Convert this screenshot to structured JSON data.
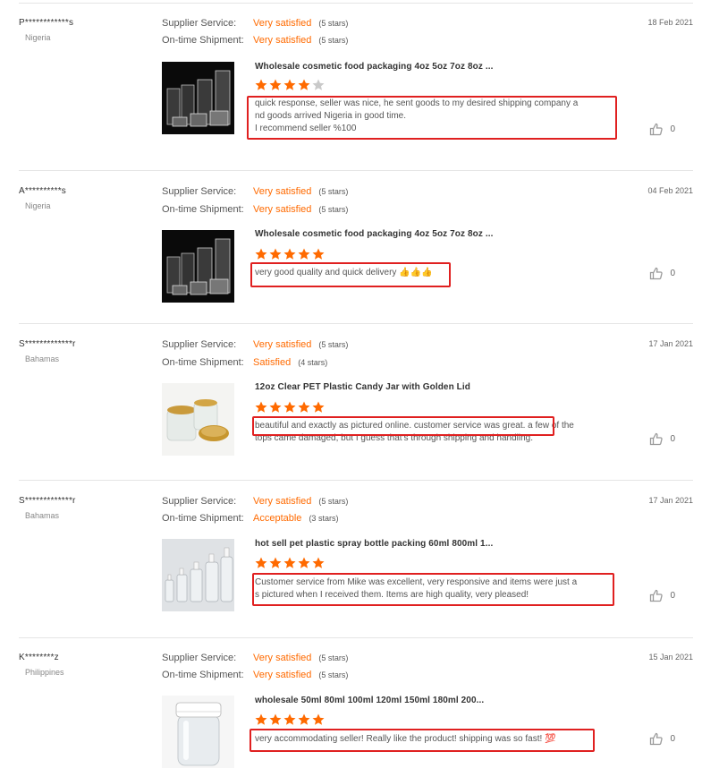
{
  "ratings_labels": {
    "supplier": "Supplier Service:",
    "shipment": "On-time Shipment:"
  },
  "reviews": [
    {
      "buyer": "P************s",
      "country": "Nigeria",
      "date": "18 Feb 2021",
      "supplier_rating": "Very satisfied",
      "supplier_stars": "(5 stars)",
      "shipment_rating": "Very satisfied",
      "shipment_stars": "(5 stars)",
      "product_title": "Wholesale cosmetic food packaging 4oz 5oz 7oz 8oz ...",
      "product_stars": 4,
      "comment_lines": [
        "quick response, seller was nice, he sent goods to my desired shipping company a",
        "nd goods arrived Nigeria in good time.",
        "I recommend seller %100"
      ],
      "helpful_count": "0",
      "thumb_image": "clear-jars-black-background"
    },
    {
      "buyer": "A**********s",
      "country": "Nigeria",
      "date": "04 Feb 2021",
      "supplier_rating": "Very satisfied",
      "supplier_stars": "(5 stars)",
      "shipment_rating": "Very satisfied",
      "shipment_stars": "(5 stars)",
      "product_title": "Wholesale cosmetic food packaging 4oz 5oz 7oz 8oz ...",
      "product_stars": 5,
      "comment_lines": [
        "very good quality and quick delivery 👍👍👍"
      ],
      "helpful_count": "0",
      "thumb_image": "clear-jars-black-background"
    },
    {
      "buyer": "S*************r",
      "country": "Bahamas",
      "date": "17 Jan 2021",
      "supplier_rating": "Very satisfied",
      "supplier_stars": "(5 stars)",
      "shipment_rating": "Satisfied",
      "shipment_stars": "(4 stars)",
      "product_title": "12oz Clear PET Plastic Candy Jar with Golden Lid",
      "product_stars": 5,
      "comment_lines": [
        "beautiful and exactly as pictured online. customer service was great. a few of the",
        "tops came damaged, but I guess that's through shipping and handling."
      ],
      "helpful_count": "0",
      "thumb_image": "jars-with-golden-lids"
    },
    {
      "buyer": "S*************r",
      "country": "Bahamas",
      "date": "17 Jan 2021",
      "supplier_rating": "Very satisfied",
      "supplier_stars": "(5 stars)",
      "shipment_rating": "Acceptable",
      "shipment_stars": "(3 stars)",
      "product_title": "hot sell pet plastic spray bottle packing 60ml 800ml 1...",
      "product_stars": 5,
      "comment_lines": [
        "Customer service from Mike was excellent, very responsive and items were just a",
        "s pictured when I received them. Items are high quality, very pleased!"
      ],
      "helpful_count": "0",
      "thumb_image": "clear-spray-bottles"
    },
    {
      "buyer": "K********z",
      "country": "Philippines",
      "date": "15 Jan 2021",
      "supplier_rating": "Very satisfied",
      "supplier_stars": "(5 stars)",
      "shipment_rating": "Very satisfied",
      "shipment_stars": "(5 stars)",
      "product_title": "wholesale 50ml 80ml 100ml 120ml 150ml 180ml 200...",
      "product_stars": 5,
      "comment_lines": [
        "very accommodating seller! Really like the product! shipping was so fast! 💯"
      ],
      "helpful_count": "0",
      "thumb_image": "clear-jar-white-lid"
    }
  ],
  "colors": {
    "accent": "#ff6a00",
    "highlight": "#e02020",
    "divider": "#e5e5e5"
  }
}
